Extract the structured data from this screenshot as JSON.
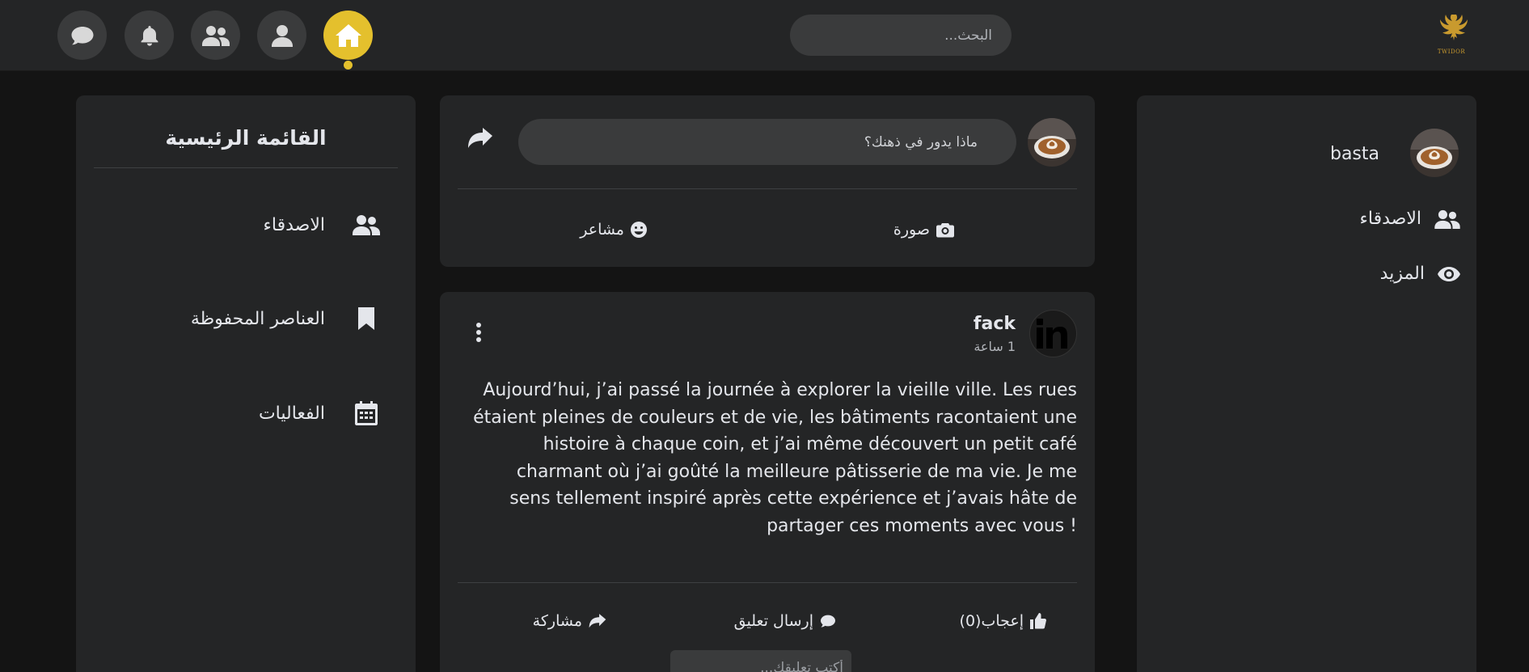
{
  "colors": {
    "accent": "#e4c02d",
    "bg": "#141414",
    "card": "#242526",
    "input": "#3a3b3c"
  },
  "topbar": {
    "nav": [
      {
        "name": "home",
        "icon": "home-icon",
        "active": true
      },
      {
        "name": "profile",
        "icon": "user-icon",
        "active": false
      },
      {
        "name": "friends",
        "icon": "users-icon",
        "active": false
      },
      {
        "name": "notifications",
        "icon": "bell-icon",
        "active": false
      },
      {
        "name": "messages",
        "icon": "comment-icon",
        "active": false
      }
    ],
    "search_placeholder": "البحث...",
    "logo_text": "TWIDOR"
  },
  "profile": {
    "name": "basta",
    "menu": [
      {
        "label": "الاصدقاء",
        "icon": "users-icon"
      },
      {
        "label": "المزيد",
        "icon": "eye-icon"
      }
    ]
  },
  "composer": {
    "placeholder": "ماذا يدور في ذهنك؟",
    "actions": [
      {
        "label": "صورة",
        "icon": "camera-icon"
      },
      {
        "label": "مشاعر",
        "icon": "smile-icon"
      }
    ]
  },
  "post": {
    "author": "fack",
    "time": "1 ساعة",
    "body": "Aujourd’hui, j’ai passé la journée à explorer la vieille ville. Les rues étaient pleines de couleurs et de vie, les bâtiments racontaient une histoire à chaque coin, et j’ai même découvert un petit café charmant où j’ai goûté la meilleure pâtisserie de ma vie. Je me sens tellement inspiré après cette expérience et j’avais hâte de partager ces moments avec vous !",
    "actions": {
      "like": "إعجاب(0)",
      "comment": "إرسال تعليق",
      "share": "مشاركة"
    },
    "comment_placeholder": "أكتب تعليقك..."
  },
  "left_menu": {
    "title": "القائمة الرئيسية",
    "items": [
      {
        "label": "الاصدقاء",
        "icon": "users-icon"
      },
      {
        "label": "العناصر المحفوظة",
        "icon": "bookmark-icon"
      },
      {
        "label": "الفعاليات",
        "icon": "calendar-icon"
      }
    ]
  }
}
